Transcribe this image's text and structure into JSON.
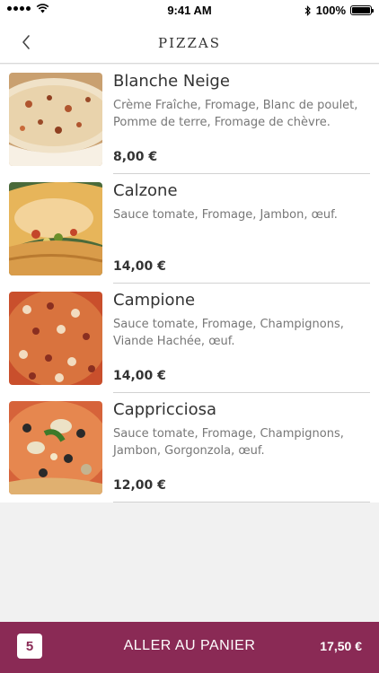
{
  "status_bar": {
    "time": "9:41 AM",
    "battery": "100%",
    "icons": [
      "signal-icon",
      "wifi-icon",
      "bluetooth-icon",
      "battery-icon"
    ]
  },
  "header": {
    "title": "PIZZAS",
    "back_icon": "chevron-left-icon"
  },
  "products": [
    {
      "name": "Blanche Neige",
      "description": "Crème Fraîche, Fromage, Blanc de poulet, Pomme de terre, Fromage de chèvre.",
      "price": "8,00 €"
    },
    {
      "name": "Calzone",
      "description": "Sauce tomate, Fromage, Jambon, œuf.",
      "price": "14,00 €"
    },
    {
      "name": "Campione",
      "description": "Sauce tomate, Fromage, Champignons, Viande Hachée, œuf.",
      "price": "14,00 €"
    },
    {
      "name": "Cappricciosa",
      "description": "Sauce tomate, Fromage, Champignons, Jambon, Gorgonzola, œuf.",
      "price": "12,00 €"
    }
  ],
  "cart": {
    "count": "5",
    "label": "ALLER AU PANIER",
    "total": "17,50 €"
  },
  "colors": {
    "accent": "#8a2a55",
    "background": "#f1f1f1"
  }
}
